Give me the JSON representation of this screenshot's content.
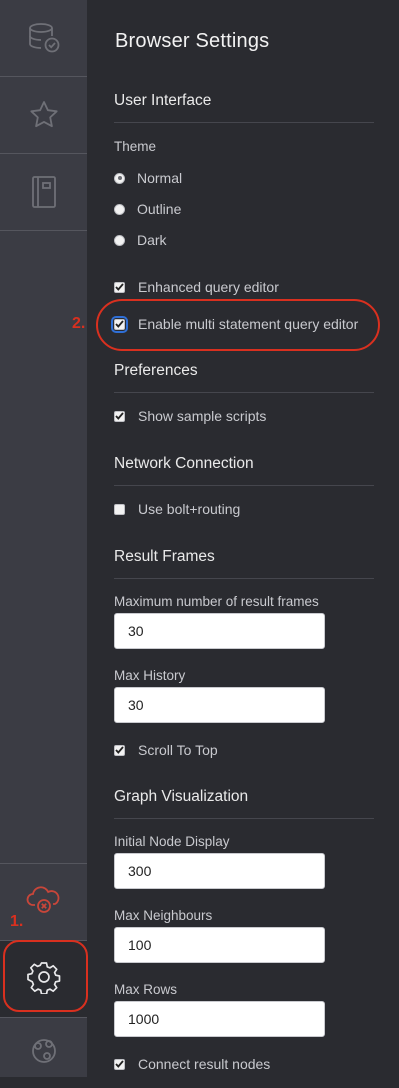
{
  "sidebar": {
    "items": [
      {
        "icon": "database-check-icon"
      },
      {
        "icon": "star-icon"
      },
      {
        "icon": "notebook-icon"
      }
    ],
    "bottom": [
      {
        "icon": "cloud-disconnected-icon",
        "status_color": "#d9301f"
      },
      {
        "icon": "gear-icon"
      },
      {
        "icon": "help-icon"
      }
    ]
  },
  "drawer": {
    "title": "Browser Settings",
    "user_interface": {
      "heading": "User Interface",
      "theme_label": "Theme",
      "themes": [
        {
          "label": "Normal",
          "selected": true
        },
        {
          "label": "Outline",
          "selected": false
        },
        {
          "label": "Dark",
          "selected": false
        }
      ],
      "enhanced_editor": {
        "label": "Enhanced query editor",
        "checked": true
      },
      "multi_statement": {
        "label": "Enable multi statement query editor",
        "checked": true
      }
    },
    "preferences": {
      "heading": "Preferences",
      "show_sample_scripts": {
        "label": "Show sample scripts",
        "checked": true
      }
    },
    "network": {
      "heading": "Network Connection",
      "bolt_routing": {
        "label": "Use bolt+routing",
        "checked": false
      }
    },
    "result_frames": {
      "heading": "Result Frames",
      "max_frames_label": "Maximum number of result frames",
      "max_frames_value": "30",
      "max_history_label": "Max History",
      "max_history_value": "30",
      "scroll_to_top": {
        "label": "Scroll To Top",
        "checked": true
      }
    },
    "graph": {
      "heading": "Graph Visualization",
      "initial_node_label": "Initial Node Display",
      "initial_node_value": "300",
      "max_neighbours_label": "Max Neighbours",
      "max_neighbours_value": "100",
      "max_rows_label": "Max Rows",
      "max_rows_value": "1000",
      "connect_result_nodes": {
        "label": "Connect result nodes",
        "checked": true
      }
    }
  },
  "annotations": {
    "marker_1": "1.",
    "marker_2": "2.",
    "highlight_color": "#d9301f"
  }
}
